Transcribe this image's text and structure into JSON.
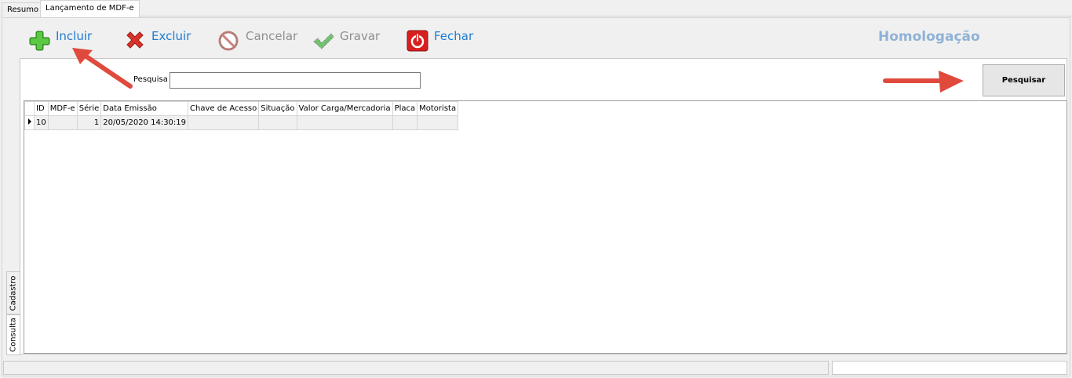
{
  "tabs": [
    "Resumo",
    "Lançamento de MDF-e"
  ],
  "toolbar": {
    "incluir": "Incluir",
    "excluir": "Excluir",
    "cancelar": "Cancelar",
    "gravar": "Gravar",
    "fechar": "Fechar"
  },
  "environment": "Homologação",
  "search": {
    "label": "Pesquisa",
    "value": "",
    "button": "Pesquisar"
  },
  "grid": {
    "columns": [
      "ID",
      "MDF-e",
      "Série",
      "Data Emissão",
      "Chave de Acesso",
      "Situação",
      "Valor Carga/Mercadoria",
      "Placa",
      "Motorista"
    ],
    "rows": [
      {
        "id": "10",
        "mdfe": "",
        "serie": "1",
        "data_emissao": "20/05/2020 14:30:19",
        "chave": "",
        "situacao": "",
        "valor": "",
        "placa": "",
        "motorista": ""
      }
    ]
  },
  "side_tabs": [
    "Cadastro",
    "Consulta"
  ],
  "colors": {
    "accent_blue": "#1e7bd0",
    "env_label": "#8fb2d6",
    "annotation_arrow": "#e04a3c"
  }
}
